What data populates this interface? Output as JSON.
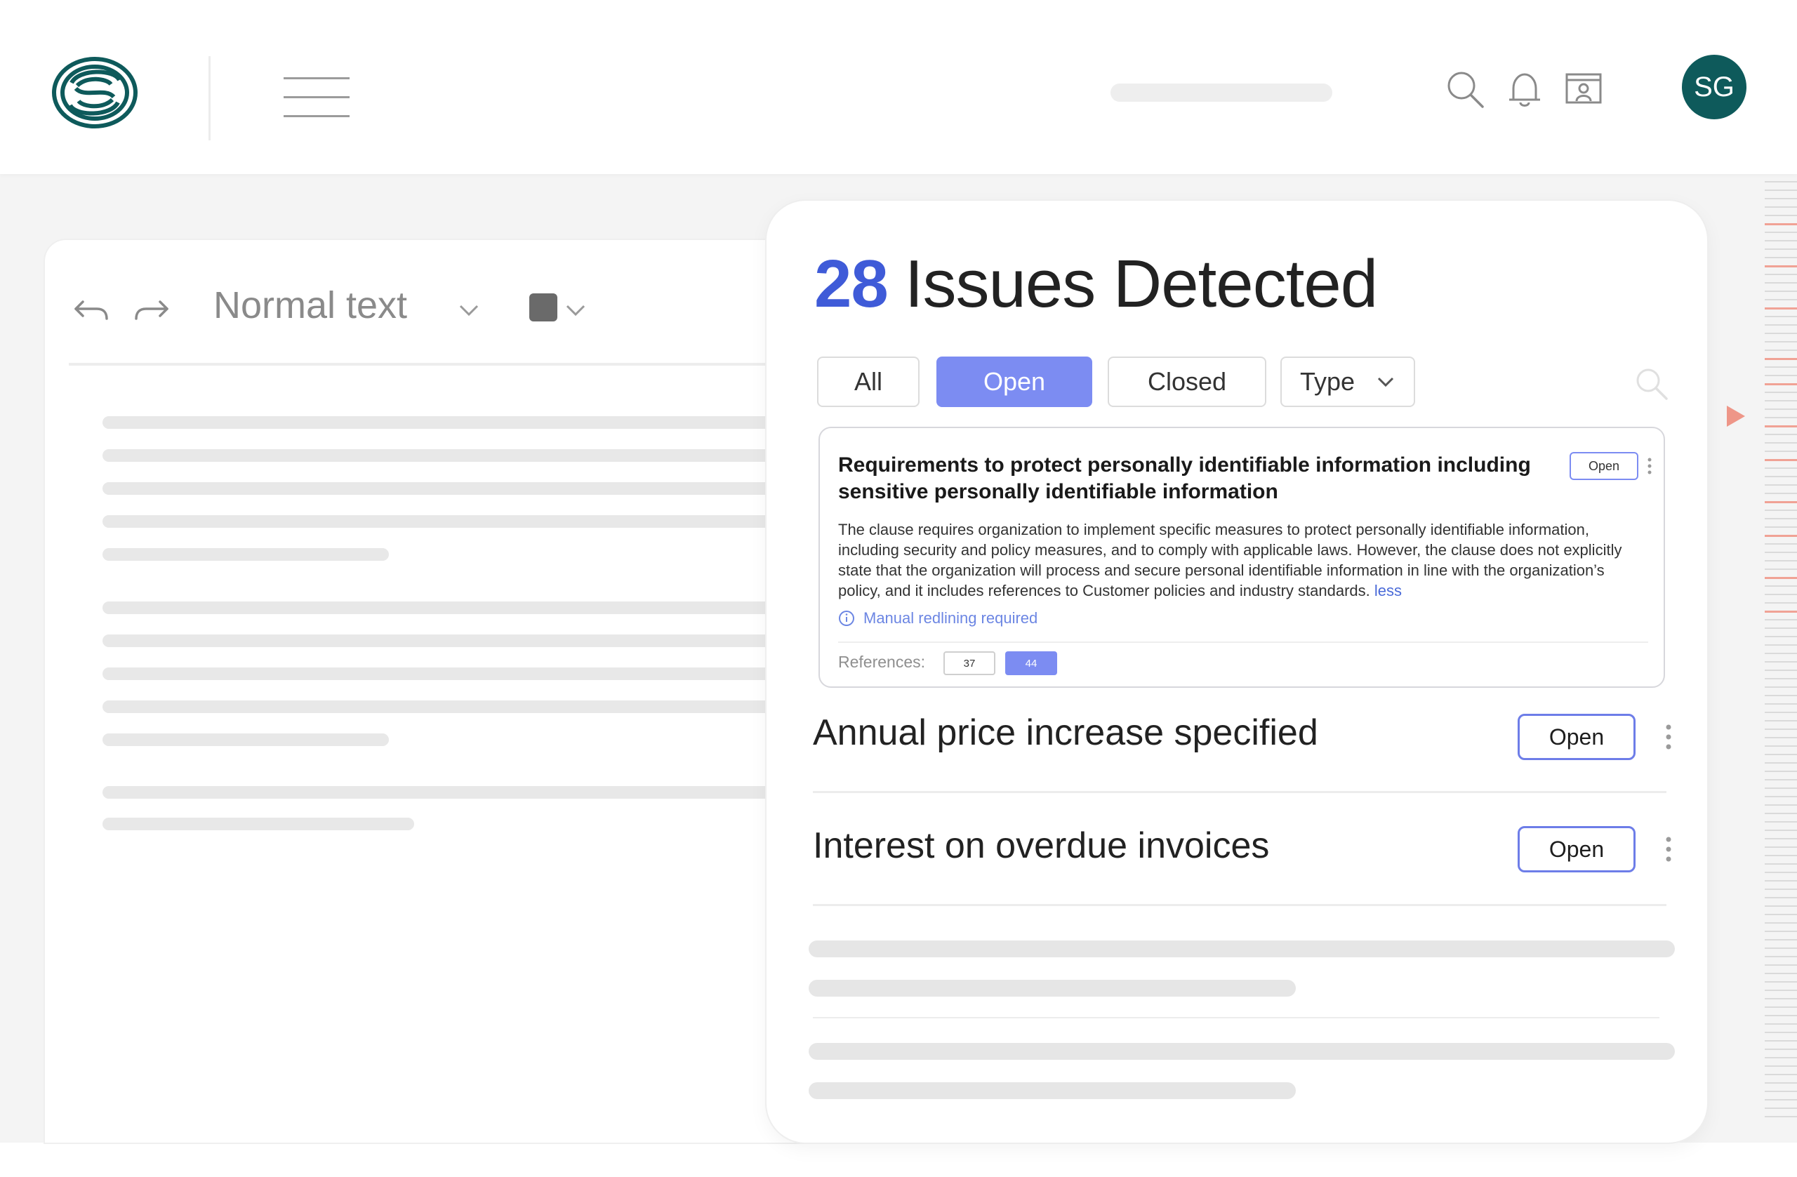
{
  "header": {
    "logo_icon": "brand-logo-rings",
    "menu_icon": "hamburger-icon",
    "icons": [
      "search-icon",
      "bell-icon",
      "screen-share-icon"
    ],
    "avatar_initials": "SG",
    "brand_color": "#0e5a5b"
  },
  "editor": {
    "undo_icon": "undo-icon",
    "redo_icon": "redo-icon",
    "text_style": "Normal text",
    "color_swatch": "#6a6a6a"
  },
  "issues": {
    "count": "28",
    "title": "Issues Detected",
    "filters": [
      {
        "label": "All",
        "active": false
      },
      {
        "label": "Open",
        "active": true
      },
      {
        "label": "Closed",
        "active": false
      },
      {
        "label": "Type",
        "active": false
      }
    ],
    "accent_color": "#7c8cf2",
    "detail": {
      "title": "Requirements to protect personally identifiable information including sensitive personally identifiable information",
      "status": "Open",
      "body": "The clause requires organization to implement specific measures to protect personally identifiable information, including security and policy measures, and to comply with applicable laws. However, the clause does not explicitly state that the organization will process and secure personal identifiable information in line with the organization’s policy, and it includes references to Customer policies and industry standards.",
      "less_link": "less",
      "note": "Manual redlining required",
      "references_label": "References:",
      "references": [
        "37",
        "44"
      ]
    },
    "list": [
      {
        "title": "Annual price increase specified",
        "status": "Open"
      },
      {
        "title": "Interest on overdue invoices",
        "status": "Open"
      }
    ]
  }
}
